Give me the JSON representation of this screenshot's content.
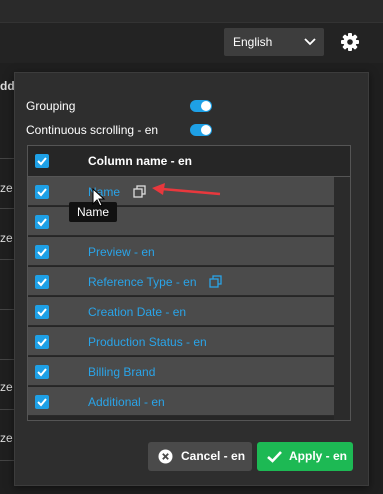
{
  "header": {
    "language": "English"
  },
  "background": {
    "fragments": [
      "ddi",
      "ze",
      "ze",
      "ze",
      "ze"
    ]
  },
  "panel": {
    "options": [
      {
        "label": "Grouping",
        "enabled": true
      },
      {
        "label": "Continuous scrolling - en",
        "enabled": true
      }
    ],
    "table": {
      "header": "Column name - en",
      "header_checked": true,
      "rows": [
        {
          "label": "Name",
          "checked": true,
          "copy_icon": true
        },
        {
          "label": "",
          "checked": true,
          "copy_icon": false
        },
        {
          "label": "Preview - en",
          "checked": true,
          "copy_icon": false
        },
        {
          "label": "Reference Type - en",
          "checked": true,
          "copy_icon": true
        },
        {
          "label": "Creation Date - en",
          "checked": true,
          "copy_icon": false
        },
        {
          "label": "Production Status - en",
          "checked": true,
          "copy_icon": false
        },
        {
          "label": "Billing Brand",
          "checked": true,
          "copy_icon": false
        },
        {
          "label": "Additional - en",
          "checked": true,
          "copy_icon": false
        }
      ]
    },
    "tooltip": "Name",
    "buttons": {
      "cancel": "Cancel - en",
      "apply": "Apply - en"
    }
  },
  "colors": {
    "accent": "#1ea0e6",
    "link": "#2aa4e8",
    "apply": "#1db954",
    "annotation_arrow": "#e8383d"
  }
}
